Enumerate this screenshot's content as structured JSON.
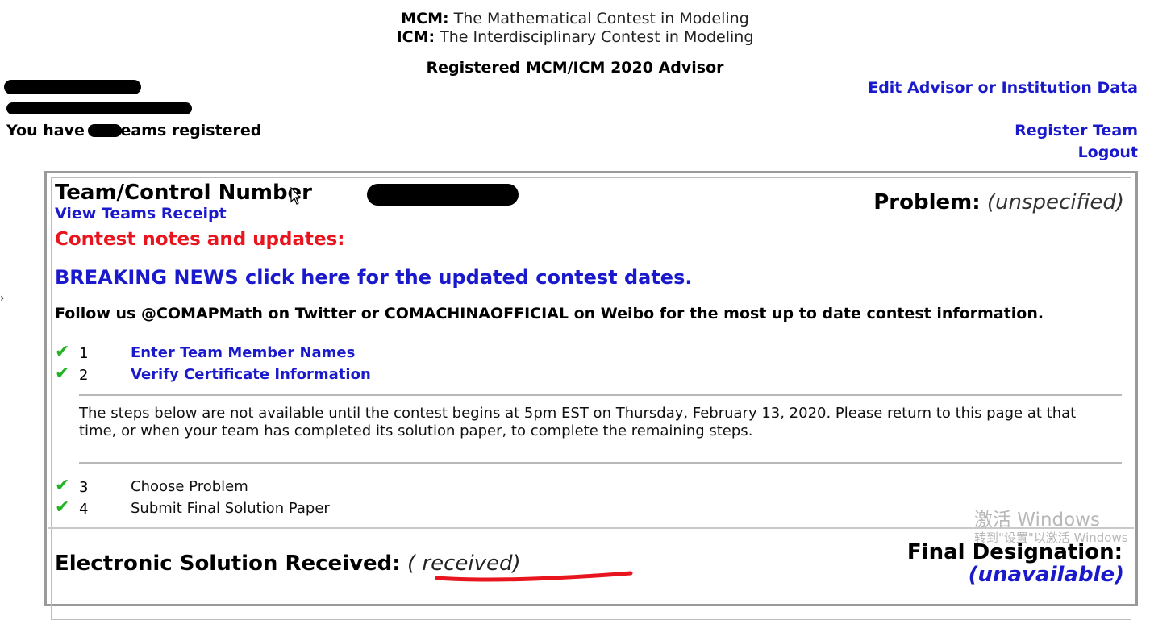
{
  "header": {
    "mcm_abbr": "MCM:",
    "mcm_text": "The Mathematical Contest in Modeling",
    "icm_abbr": "ICM:",
    "icm_text": "The Interdisciplinary Contest in Modeling",
    "registered_title": "Registered MCM/ICM 2020 Advisor"
  },
  "advisor": {
    "teams_prefix": "You have ",
    "teams_suffix": "eams registered"
  },
  "nav": {
    "edit_link": "Edit Advisor or Institution Data",
    "register_link": "Register Team",
    "logout_link": "Logout"
  },
  "team_panel": {
    "control_label": "Team/Control Number",
    "receipt_link": "View Teams Receipt",
    "problem_label": "Problem:",
    "problem_value": "(unspecified)",
    "notes_heading": "Contest notes and updates:",
    "breaking_news_link": "BREAKING NEWS click here for the updated contest dates.",
    "follow_text": "Follow us @COMAPMath on Twitter or COMACHINAOFFICIAL on Weibo for the most up to date contest information.",
    "steps_top": [
      {
        "num": "1",
        "label": "Enter Team Member Names"
      },
      {
        "num": "2",
        "label": "Verify Certificate Information"
      }
    ],
    "notice": "The steps below are not available until the contest begins at 5pm EST on Thursday, February 13, 2020. Please return to this page at that time, or when your team has completed its solution paper, to complete the remaining steps.",
    "steps_bottom": [
      {
        "num": "3",
        "label": "Choose Problem"
      },
      {
        "num": "4",
        "label": "Submit Final Solution Paper"
      }
    ],
    "electronic_label": "Electronic Solution Received:",
    "electronic_value": "( received)",
    "final_label": "Final Designation:",
    "final_value": "(unavailable)"
  },
  "watermark": {
    "line1": "激活 Windows",
    "line2": "转到\"设置\"以激活 Windows"
  },
  "colors": {
    "link": "#1a1acc",
    "notes_red": "#e8141e",
    "check_green": "#22b422",
    "annotation_red": "#e8141e"
  }
}
